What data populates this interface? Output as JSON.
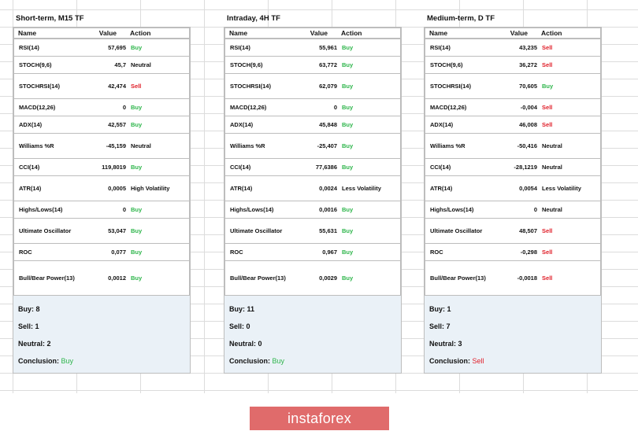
{
  "panels": [
    {
      "title": "Short-term, M15 TF",
      "headers": {
        "name": "Name",
        "value": "Value",
        "action": "Action"
      },
      "rows": [
        {
          "name": "RSI(14)",
          "value": "57,695",
          "action": "Buy",
          "status": "buy"
        },
        {
          "name": "STOCH(9,6)",
          "value": "45,7",
          "action": "Neutral",
          "status": "neutral"
        },
        {
          "name": "STOCHRSI(14)",
          "value": "42,474",
          "action": "Sell",
          "status": "sell"
        },
        {
          "name": "MACD(12,26)",
          "value": "0",
          "action": "Buy",
          "status": "buy"
        },
        {
          "name": "ADX(14)",
          "value": "42,557",
          "action": "Buy",
          "status": "buy"
        },
        {
          "name": "Williams %R",
          "value": "-45,159",
          "action": "Neutral",
          "status": "neutral"
        },
        {
          "name": "CCI(14)",
          "value": "119,8019",
          "action": "Buy",
          "status": "buy"
        },
        {
          "name": "ATR(14)",
          "value": "0,0005",
          "action": "High Volatility",
          "status": "neutral"
        },
        {
          "name": "Highs/Lows(14)",
          "value": "0",
          "action": "Buy",
          "status": "buy"
        },
        {
          "name": "Ultimate Oscillator",
          "value": "53,047",
          "action": "Buy",
          "status": "buy"
        },
        {
          "name": "ROC",
          "value": "0,077",
          "action": "Buy",
          "status": "buy"
        },
        {
          "name": "Bull/Bear Power(13)",
          "value": "0,0012",
          "action": "Buy",
          "status": "buy"
        }
      ],
      "summary": {
        "buy": "Buy: 8",
        "sell": "Sell: 1",
        "neutral": "Neutral: 2",
        "conclusion_label": "Conclusion:",
        "conclusion": "Buy",
        "conclusion_status": "buy"
      }
    },
    {
      "title": "Intraday, 4H TF",
      "headers": {
        "name": "Name",
        "value": "Value",
        "action": "Action"
      },
      "rows": [
        {
          "name": "RSI(14)",
          "value": "55,961",
          "action": "Buy",
          "status": "buy"
        },
        {
          "name": "STOCH(9,6)",
          "value": "63,772",
          "action": "Buy",
          "status": "buy"
        },
        {
          "name": "STOCHRSI(14)",
          "value": "62,079",
          "action": "Buy",
          "status": "buy"
        },
        {
          "name": "MACD(12,26)",
          "value": "0",
          "action": "Buy",
          "status": "buy"
        },
        {
          "name": "ADX(14)",
          "value": "45,848",
          "action": "Buy",
          "status": "buy"
        },
        {
          "name": "Williams %R",
          "value": "-25,407",
          "action": "Buy",
          "status": "buy"
        },
        {
          "name": "CCI(14)",
          "value": "77,6386",
          "action": "Buy",
          "status": "buy"
        },
        {
          "name": "ATR(14)",
          "value": "0,0024",
          "action": "Less Volatility",
          "status": "neutral"
        },
        {
          "name": "Highs/Lows(14)",
          "value": "0,0016",
          "action": "Buy",
          "status": "buy"
        },
        {
          "name": "Ultimate Oscillator",
          "value": "55,631",
          "action": "Buy",
          "status": "buy"
        },
        {
          "name": "ROC",
          "value": "0,967",
          "action": "Buy",
          "status": "buy"
        },
        {
          "name": "Bull/Bear Power(13)",
          "value": "0,0029",
          "action": "Buy",
          "status": "buy"
        }
      ],
      "summary": {
        "buy": "Buy: 11",
        "sell": "Sell: 0",
        "neutral": "Neutral: 0",
        "conclusion_label": "Conclusion:",
        "conclusion": "Buy",
        "conclusion_status": "buy"
      }
    },
    {
      "title": "Medium-term, D TF",
      "headers": {
        "name": "Name",
        "value": "Value",
        "action": "Action"
      },
      "rows": [
        {
          "name": "RSI(14)",
          "value": "43,235",
          "action": "Sell",
          "status": "sell"
        },
        {
          "name": "STOCH(9,6)",
          "value": "36,272",
          "action": "Sell",
          "status": "sell"
        },
        {
          "name": "STOCHRSI(14)",
          "value": "70,605",
          "action": "Buy",
          "status": "buy"
        },
        {
          "name": "MACD(12,26)",
          "value": "-0,004",
          "action": "Sell",
          "status": "sell"
        },
        {
          "name": "ADX(14)",
          "value": "46,008",
          "action": "Sell",
          "status": "sell"
        },
        {
          "name": "Williams %R",
          "value": "-50,416",
          "action": "Neutral",
          "status": "neutral"
        },
        {
          "name": "CCI(14)",
          "value": "-28,1219",
          "action": "Neutral",
          "status": "neutral"
        },
        {
          "name": "ATR(14)",
          "value": "0,0054",
          "action": "Less Volatility",
          "status": "neutral"
        },
        {
          "name": "Highs/Lows(14)",
          "value": "0",
          "action": "Neutral",
          "status": "neutral"
        },
        {
          "name": "Ultimate Oscillator",
          "value": "48,507",
          "action": "Sell",
          "status": "sell"
        },
        {
          "name": "ROC",
          "value": "-0,298",
          "action": "Sell",
          "status": "sell"
        },
        {
          "name": "Bull/Bear Power(13)",
          "value": "-0,0018",
          "action": "Sell",
          "status": "sell"
        }
      ],
      "summary": {
        "buy": "Buy: 1",
        "sell": "Sell: 7",
        "neutral": "Neutral: 3",
        "conclusion_label": "Conclusion:",
        "conclusion": "Sell",
        "conclusion_status": "sell"
      }
    }
  ],
  "logo_text": "instaforex",
  "colors": {
    "buy": "#2db54a",
    "sell": "#e0202a",
    "summary_bg": "#eaf1f7",
    "logo_bg": "#e06b6b"
  }
}
